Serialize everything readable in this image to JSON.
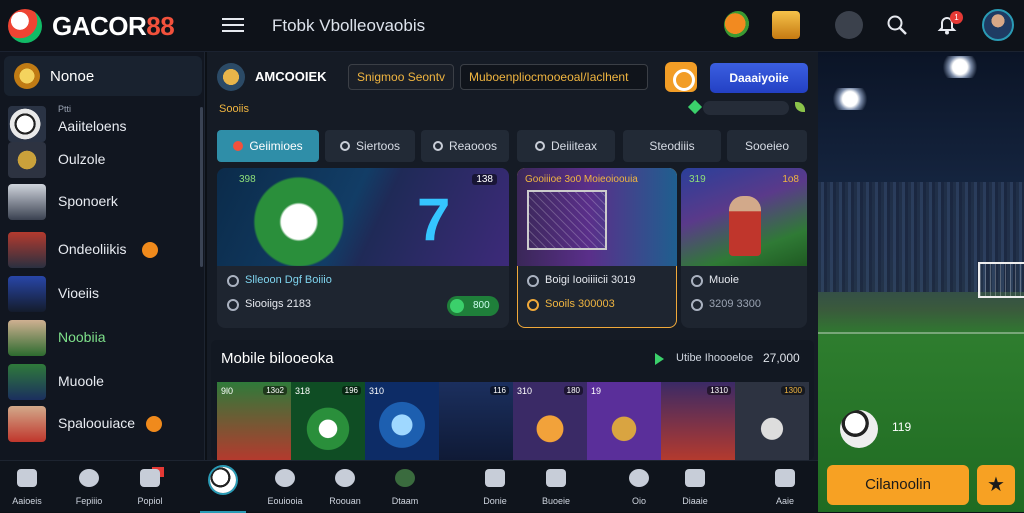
{
  "brand": {
    "name_a": "GACOR",
    "name_b": "88"
  },
  "header": {
    "title": "Ftobk Vbolleovaobis",
    "icons": [
      "menu-icon",
      "fruit-icon",
      "trophy-icon",
      "shield-icon",
      "search-icon",
      "bell-icon",
      "user-avatar"
    ],
    "notification_badge": "1"
  },
  "sidebar": {
    "home_label": "Nonoe",
    "items": [
      {
        "sub": "Ptti",
        "label": "Aaiiteloens",
        "dot": false
      },
      {
        "sub": "",
        "label": "Oulzole",
        "dot": false
      },
      {
        "sub": "",
        "label": "Sponoerk",
        "dot": false
      },
      {
        "sub": "",
        "label": "Ondeoliikis",
        "dot": true
      },
      {
        "sub": "",
        "label": "Vioeiis",
        "dot": false
      },
      {
        "sub": "",
        "label": "Noobiia",
        "dot": false
      },
      {
        "sub": "",
        "label": "Muoole",
        "dot": false
      },
      {
        "sub": "",
        "label": "Spaloouiace",
        "dot": true
      }
    ]
  },
  "bottom_nav": [
    {
      "label": "Aaioeis"
    },
    {
      "label": "Fepiiio"
    },
    {
      "label": "Popiol"
    },
    {
      "label": ""
    },
    {
      "label": "Eouiooia"
    },
    {
      "label": "Roouan"
    },
    {
      "label": "Dtaam"
    },
    {
      "label": "Donie"
    },
    {
      "label": "Buoeie"
    },
    {
      "label": "Oio"
    },
    {
      "label": "Diaaie"
    },
    {
      "label": "Aaie"
    }
  ],
  "account": {
    "name": "AMCOOIEK",
    "pill_1": "Snigmoo Seontv",
    "pill_2": "Muboenpliocmooeoal/Iaclhent",
    "cta": "Daaaiyoiie",
    "section": "Sooiis"
  },
  "tabs": [
    {
      "label": "Geiimioes",
      "active": true
    },
    {
      "label": "Siertoos",
      "active": false
    },
    {
      "label": "Reaooos",
      "active": false
    },
    {
      "label": "Deiiiteax",
      "active": false
    },
    {
      "label": "Steodiiis",
      "active": false
    },
    {
      "label": "Sooeieo",
      "active": false
    }
  ],
  "cards": [
    {
      "tag": "398",
      "tag_r": "",
      "line1": "Slleoon Dgf Boiiio",
      "line2": "Siooiigs 2183",
      "toggle": "800"
    },
    {
      "tag": "",
      "tag_r": "138",
      "line1": "",
      "line2": "",
      "toggle": ""
    },
    {
      "tag": "Gooiiioe 3o0 Moieoioouia",
      "tag_r": "",
      "line1": "Boigi Iooiiiicii 3019",
      "line2": "Sooils 300003",
      "toggle": ""
    },
    {
      "tag": "319",
      "tag_r": "1o8",
      "line1": "Muoie",
      "line2": "3209 3300",
      "toggle": ""
    }
  ],
  "mobile": {
    "title": "Mobile bilooeoka",
    "link": "Utibe Ihoooeloe",
    "count": "27,000",
    "tiles": [
      {
        "tag": "9l0",
        "right": "13o2"
      },
      {
        "tag": "318",
        "right": "196"
      },
      {
        "tag": "310",
        "right": ""
      },
      {
        "tag": "",
        "right": "116"
      },
      {
        "tag": "310",
        "right": "180"
      },
      {
        "tag": "19",
        "right": ""
      },
      {
        "tag": "",
        "right": "1310"
      },
      {
        "tag": "",
        "right": "1300"
      }
    ]
  },
  "stadium": {
    "ball_label": "119",
    "button": "Cilanoolin"
  },
  "colors": {
    "accent": "#2f8ea8",
    "brand_red": "#f2513c",
    "cta_orange": "#f7a123",
    "cta_blue": "#2340c4"
  }
}
